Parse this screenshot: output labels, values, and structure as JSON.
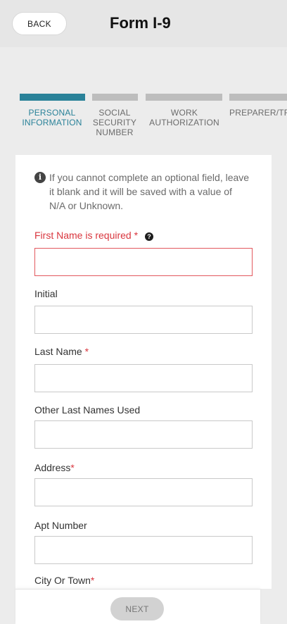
{
  "header": {
    "back_label": "BACK",
    "title": "Form I-9"
  },
  "steps": [
    {
      "label_lines": [
        "PERSONAL",
        "INFORMATION"
      ],
      "active": true
    },
    {
      "label_lines": [
        "SOCIAL",
        "SECURITY",
        "NUMBER"
      ],
      "active": false
    },
    {
      "label_lines": [
        "WORK",
        "AUTHORIZATION"
      ],
      "active": false
    },
    {
      "label_lines": [
        "PREPARER/TR"
      ],
      "active": false
    }
  ],
  "info": {
    "icon": "info-icon",
    "text": "If you cannot complete an optional field, leave it blank and it will be saved with a value of N/A or Unknown."
  },
  "fields": {
    "first_name": {
      "label": "First Name is required",
      "required_mark": "*",
      "value": "",
      "help_icon": "?"
    },
    "initial": {
      "label": "Initial",
      "value": ""
    },
    "last_name": {
      "label": "Last Name",
      "required_mark": "*",
      "value": ""
    },
    "other_last_names": {
      "label": "Other Last Names Used",
      "value": ""
    },
    "address": {
      "label": "Address",
      "required_mark": "*",
      "value": ""
    },
    "apt_number": {
      "label": "Apt Number",
      "value": ""
    },
    "city": {
      "label": "City Or Town",
      "required_mark": "*",
      "value": ""
    }
  },
  "footer": {
    "next_label": "NEXT"
  },
  "colors": {
    "accent": "#2a8299",
    "error": "#d9363e",
    "inactive_step": "#bdbdbd"
  }
}
